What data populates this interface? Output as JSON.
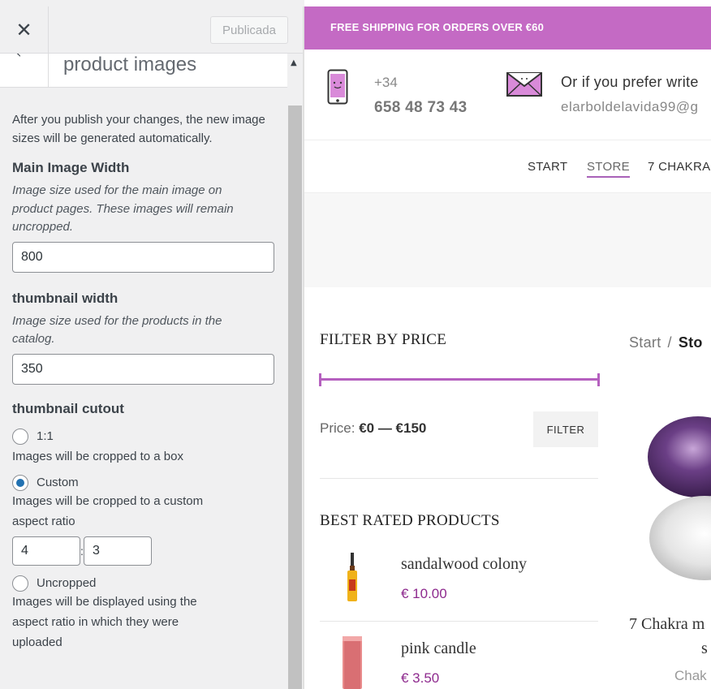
{
  "customizer": {
    "close_label": "✕",
    "publish_label": "Publicada",
    "section_title": "product images",
    "intro": "After you publish your changes, the new image sizes will be generated automatically.",
    "main_image": {
      "title": "Main Image Width",
      "note": "Image size used for the main image on product pages. These images will remain uncropped.",
      "value": "800"
    },
    "thumbnail": {
      "title": "thumbnail width",
      "note": "Image size used for the products in the catalog.",
      "value": "350"
    },
    "cutout": {
      "title": "thumbnail cutout",
      "options": [
        {
          "label": "1:1",
          "desc": "Images will be cropped to a box",
          "checked": false
        },
        {
          "label": "Custom",
          "desc": "Images will be cropped to a custom aspect ratio",
          "checked": true
        },
        {
          "label": "Uncropped",
          "desc": "Images will be displayed using the aspect ratio in which they were uploaded",
          "checked": false
        }
      ],
      "ratio_width": "4",
      "ratio_sep": ":",
      "ratio_height": "3"
    }
  },
  "preview": {
    "promo": "FREE SHIPPING FOR ORDERS OVER €60",
    "phone_code": "+34",
    "phone_number": "658 48 73 43",
    "contact_label": "Or if you prefer write",
    "contact_email": "elarboldelavida99@g",
    "nav": [
      "START",
      "STORE",
      "7 CHAKRA"
    ],
    "filter": {
      "title": "FILTER BY PRICE",
      "price_label": "Price:",
      "price_range": "€0 — €150",
      "button": "FILTER"
    },
    "best_rated": {
      "title": "BEST RATED PRODUCTS",
      "products": [
        {
          "name": "sandalwood colony",
          "price": "€ 10.00"
        },
        {
          "name": "pink candle",
          "price": "€ 3.50"
        }
      ]
    },
    "breadcrumb": {
      "start": "Start",
      "sep": "/",
      "current": "Sto"
    },
    "product": {
      "title_line1": "7 Chakra m",
      "title_line2": "s",
      "category": "Chak"
    },
    "accent_color": "#c46ac4",
    "price_color": "#8e2a8e"
  }
}
